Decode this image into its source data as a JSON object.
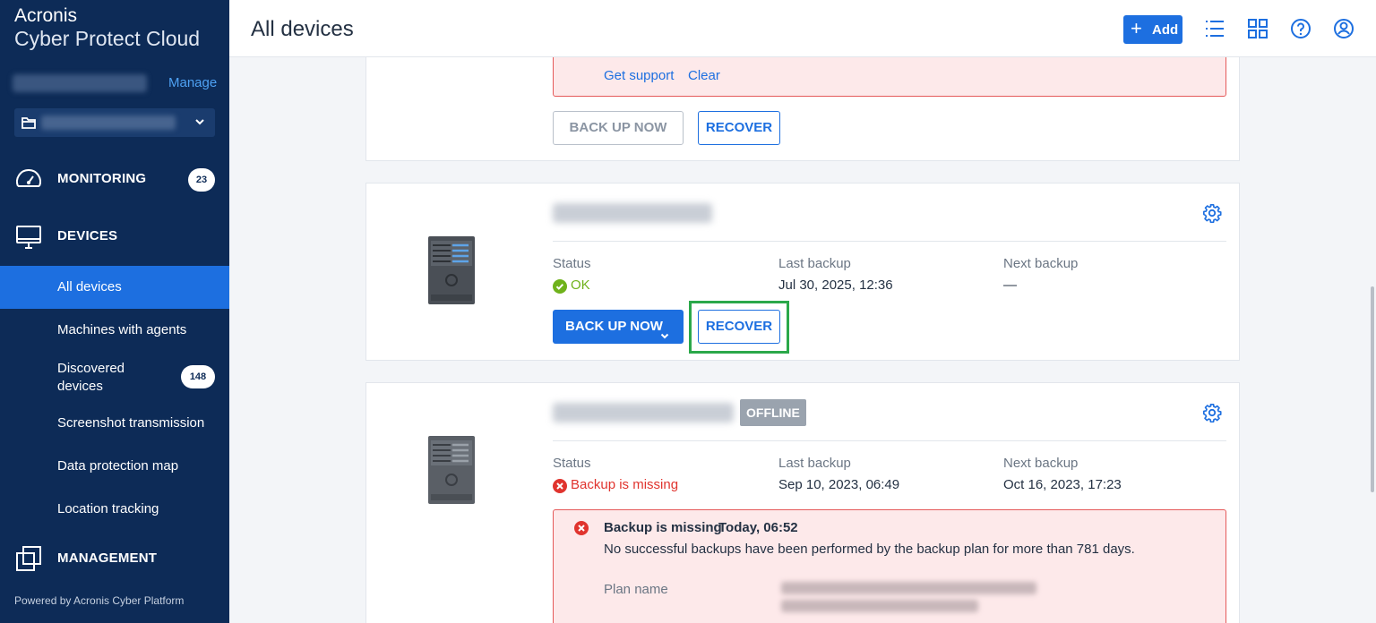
{
  "sidebar": {
    "logo_line1": "Acronis",
    "logo_line2": "Cyber Protect Cloud",
    "manage_label": "Manage",
    "monitoring": {
      "label": "MONITORING",
      "badge": "23"
    },
    "devices": {
      "label": "DEVICES"
    },
    "items": [
      {
        "label": "All devices",
        "active": true
      },
      {
        "label": "Machines with agents"
      },
      {
        "label": "Discovered devices",
        "badge": "148"
      },
      {
        "label": "Screenshot transmission"
      },
      {
        "label": "Data protection map"
      },
      {
        "label": "Location tracking"
      }
    ],
    "management": {
      "label": "MANAGEMENT"
    },
    "powered_by": "Powered by Acronis Cyber Platform"
  },
  "header": {
    "title": "All devices",
    "add_label": "Add",
    "icons": [
      "list-view-icon",
      "grid-view-icon",
      "help-icon",
      "user-account-icon"
    ]
  },
  "cards": [
    {
      "alert": {
        "get_support": "Get support",
        "clear": "Clear"
      },
      "backup_now": "BACK UP NOW",
      "recover": "RECOVER"
    },
    {
      "status_label": "Status",
      "status_value": "OK",
      "last_backup_label": "Last backup",
      "last_backup_value": "Jul 30, 2025, 12:36",
      "next_backup_label": "Next backup",
      "next_backup_value": "—",
      "backup_now": "BACK UP NOW",
      "recover": "RECOVER"
    },
    {
      "offline_badge": "OFFLINE",
      "status_label": "Status",
      "status_value": "Backup is missing",
      "last_backup_label": "Last backup",
      "last_backup_value": "Sep 10, 2023, 06:49",
      "next_backup_label": "Next backup",
      "next_backup_value": "Oct 16, 2023, 17:23",
      "alert": {
        "title": "Backup is missing",
        "time": "Today, 06:52",
        "message": "No successful backups have been performed by the backup plan for more than 781 days.",
        "plan_name_label": "Plan name"
      }
    }
  ],
  "colors": {
    "sidebar_bg": "#0d2b57",
    "accent": "#1d6fe0",
    "ok": "#6fb21b",
    "error": "#e0342e",
    "highlight": "#2ba84a"
  }
}
